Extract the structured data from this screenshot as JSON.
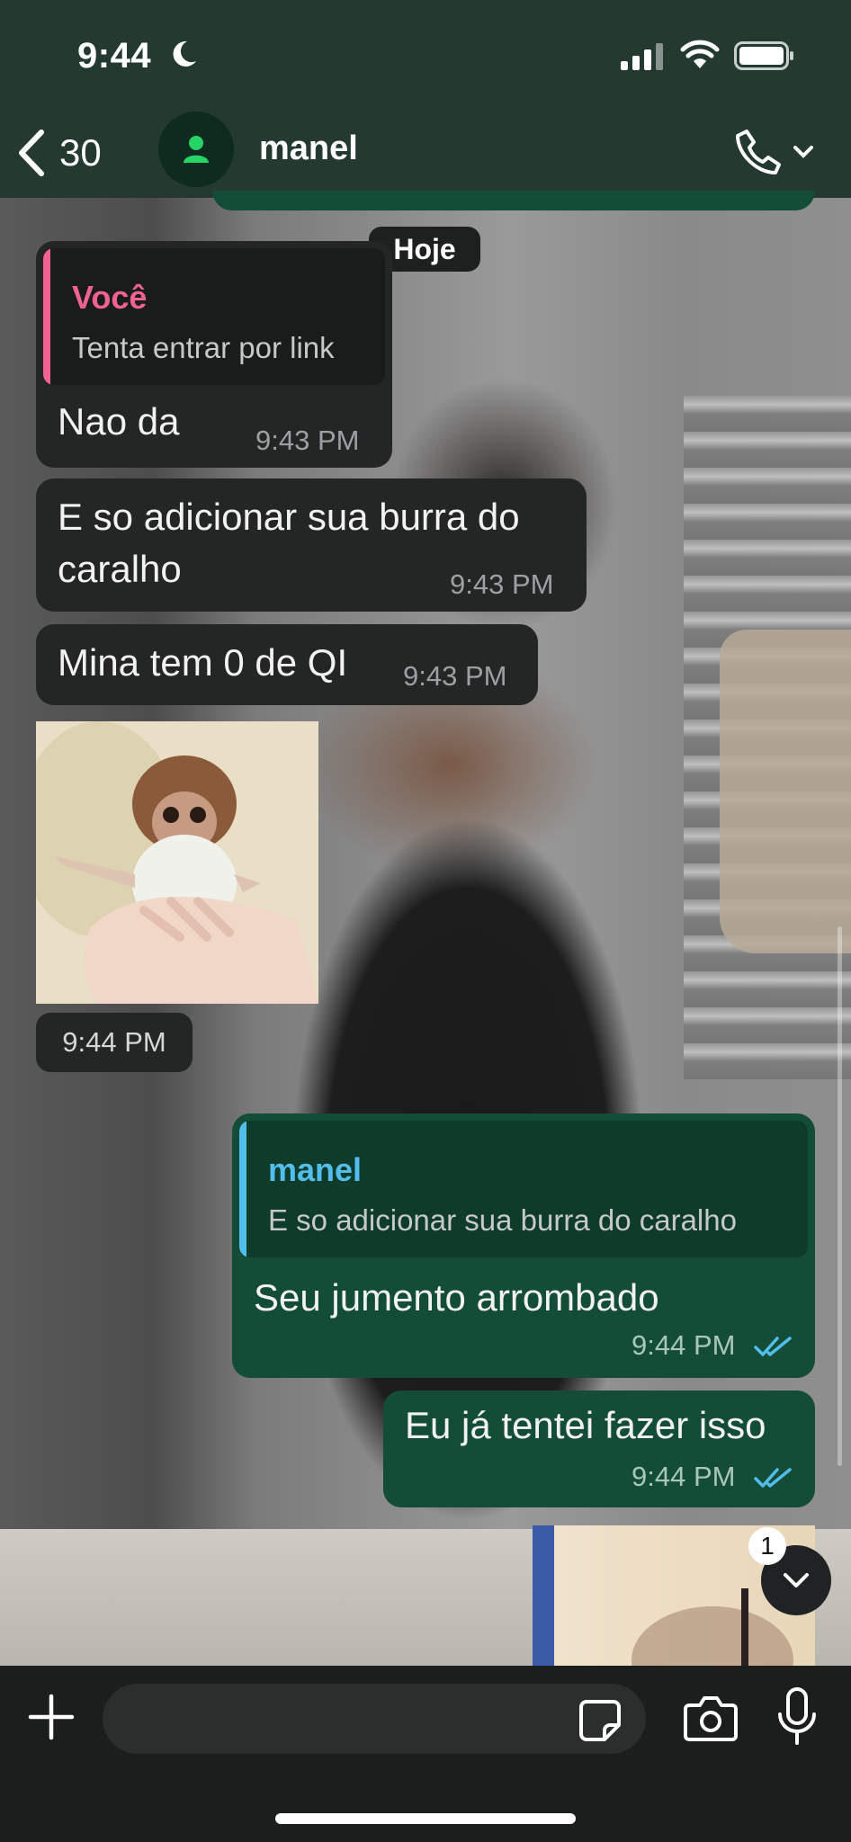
{
  "status_bar": {
    "time": "9:44",
    "icons": [
      "moon-icon",
      "signal-icon",
      "wifi-icon",
      "battery-icon"
    ]
  },
  "header": {
    "back_count": "30",
    "contact_name": "manel",
    "icons": [
      "chevron-left-icon",
      "person-icon",
      "phone-icon",
      "chevron-down-icon"
    ]
  },
  "date_separator": "Hoje",
  "messages": [
    {
      "direction": "incoming",
      "quote": {
        "author": "Você",
        "text": "Tenta entrar por link"
      },
      "text": "Nao da",
      "time": "9:43 PM"
    },
    {
      "direction": "incoming",
      "text_lines": [
        "E so adicionar sua burra do",
        "caralho"
      ],
      "time": "9:43 PM"
    },
    {
      "direction": "incoming",
      "text": "Mina tem 0 de QI",
      "time": "9:43 PM"
    },
    {
      "direction": "incoming",
      "type": "image",
      "time": "9:44 PM"
    },
    {
      "direction": "outgoing",
      "quote": {
        "author": "manel",
        "text": "E so adicionar sua burra do caralho"
      },
      "text": "Seu jumento arrombado",
      "time": "9:44 PM",
      "read": true
    },
    {
      "direction": "outgoing",
      "text": "Eu já tentei fazer isso",
      "time": "9:44 PM",
      "read": true
    }
  ],
  "unread_badge": "1",
  "input": {
    "value": "",
    "placeholder": ""
  },
  "colors": {
    "header_bg": "#243a31",
    "incoming_bubble": "#242626",
    "outgoing_bubble": "#134d37",
    "quote_you_accent": "#f06292",
    "quote_manel_accent": "#53bdeb",
    "read_ticks": "#53bdeb",
    "avatar_icon": "#25d366"
  }
}
